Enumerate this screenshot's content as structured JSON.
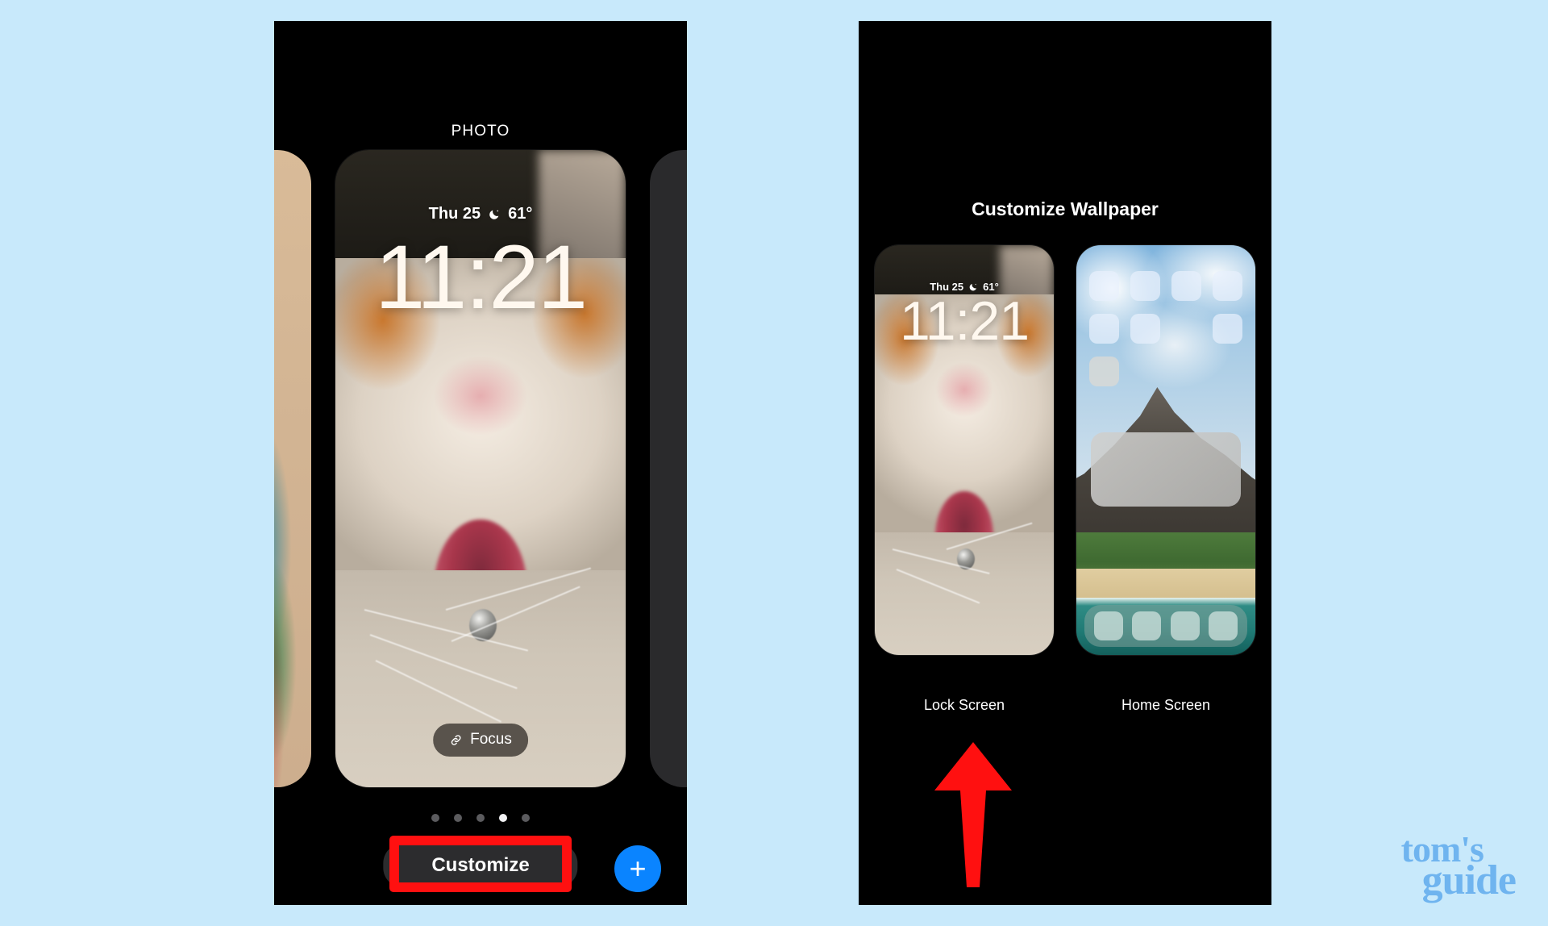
{
  "background_color": "#c8e9fb",
  "left_phone": {
    "header_label": "PHOTO",
    "lock_preview": {
      "date": "Thu 25",
      "weather_icon": "crescent-moon-icon",
      "temperature": "61°",
      "time": "11:21",
      "focus_button": {
        "icon": "link-icon",
        "label": "Focus"
      }
    },
    "page_dots": {
      "count": 5,
      "active_index": 3
    },
    "customize_button_label": "Customize",
    "add_button_label": "+",
    "highlight": {
      "color": "#ff1010",
      "target": "Customize"
    }
  },
  "right_phone": {
    "title": "Customize Wallpaper",
    "lock_preview": {
      "date": "Thu 25",
      "weather_icon": "crescent-moon-icon",
      "temperature": "61°",
      "time": "11:21",
      "label": "Lock Screen"
    },
    "home_preview": {
      "label": "Home Screen",
      "app_icon_rows": [
        4,
        3,
        1
      ],
      "dock_icon_count": 4
    },
    "annotation_arrow": {
      "color": "#ff1010",
      "direction": "up",
      "points_to": "Lock Screen"
    }
  },
  "watermark": {
    "line1": "tom's",
    "line2": "guide",
    "color": "#6fb4ef"
  },
  "colors": {
    "accent_blue": "#0a84ff",
    "highlight_red": "#ff1010",
    "phone_bg": "#000000",
    "page_bg": "#c8e9fb"
  }
}
